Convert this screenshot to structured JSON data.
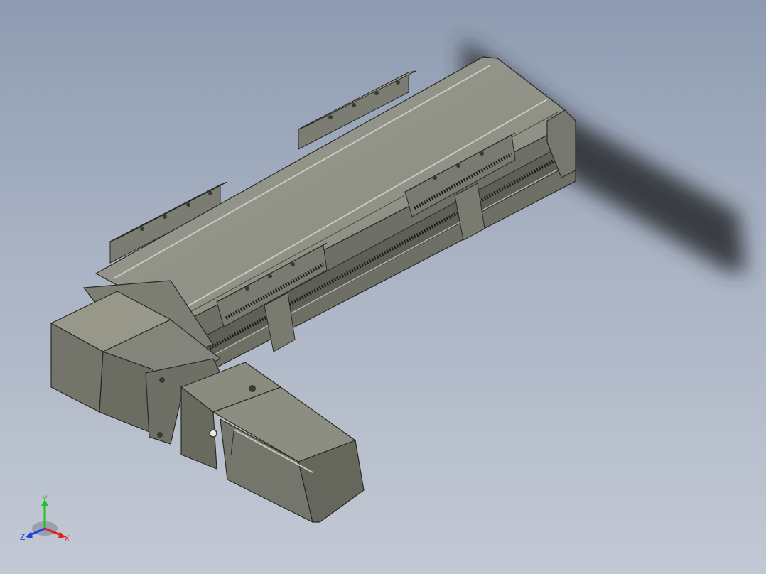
{
  "viewport": {
    "background_top": "#8e9bb1",
    "background_bottom": "#c3c9d4",
    "model_color": "#86877c"
  },
  "triad": {
    "x_label": "X",
    "y_label": "Y",
    "z_label": "Z",
    "x_color": "#e02020",
    "y_color": "#20c020",
    "z_color": "#2040e0"
  }
}
